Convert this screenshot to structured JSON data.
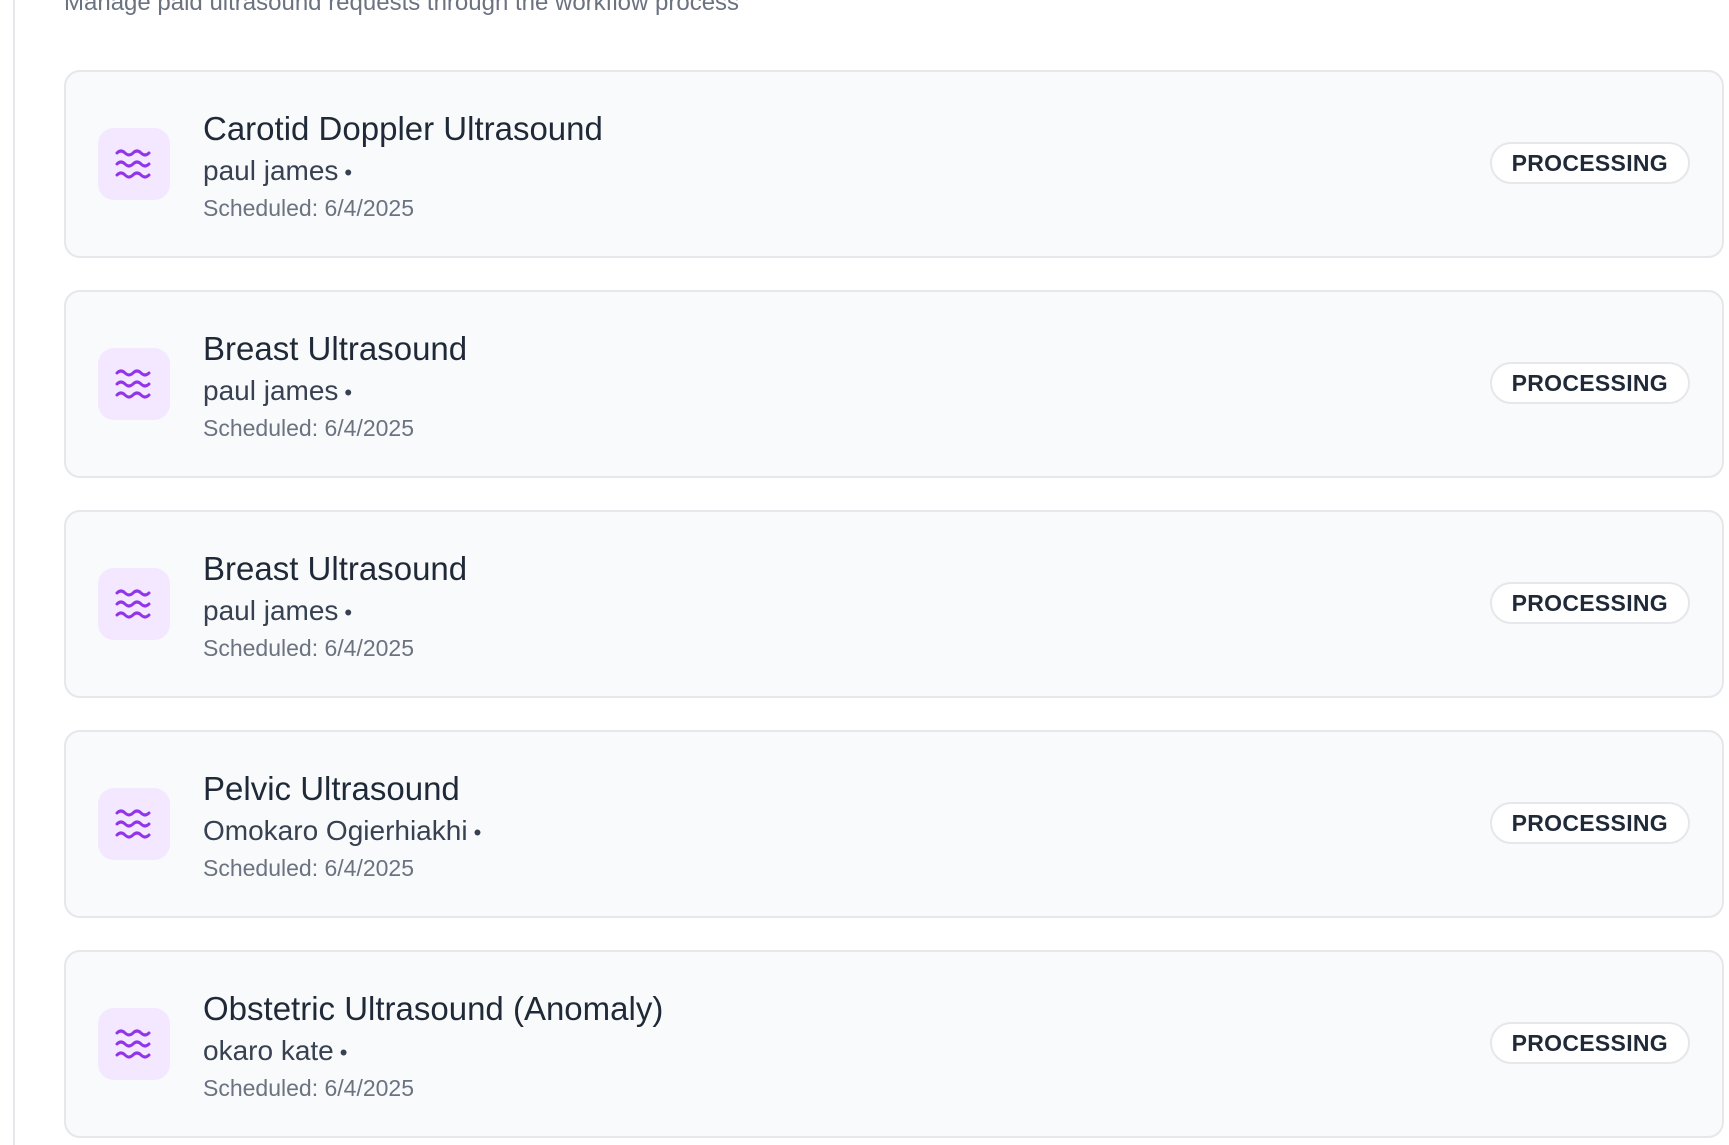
{
  "header": {
    "subtitle": "Manage paid ultrasound requests through the workflow process"
  },
  "colors": {
    "icon_bg": "#f3e8ff",
    "icon_stroke": "#9333ea",
    "card_bg": "#f9fafb",
    "border": "#e5e7eb"
  },
  "requests": [
    {
      "icon": "waves-icon",
      "title": "Carotid Doppler Ultrasound",
      "patient": "paul james",
      "separator": "•",
      "scheduled": "Scheduled: 6/4/2025",
      "status": "PROCESSING"
    },
    {
      "icon": "waves-icon",
      "title": "Breast Ultrasound",
      "patient": "paul james",
      "separator": "•",
      "scheduled": "Scheduled: 6/4/2025",
      "status": "PROCESSING"
    },
    {
      "icon": "waves-icon",
      "title": "Breast Ultrasound",
      "patient": "paul james",
      "separator": "•",
      "scheduled": "Scheduled: 6/4/2025",
      "status": "PROCESSING"
    },
    {
      "icon": "waves-icon",
      "title": "Pelvic Ultrasound",
      "patient": "Omokaro Ogierhiakhi",
      "separator": "•",
      "scheduled": "Scheduled: 6/4/2025",
      "status": "PROCESSING"
    },
    {
      "icon": "waves-icon",
      "title": "Obstetric Ultrasound (Anomaly)",
      "patient": "okaro kate",
      "separator": "•",
      "scheduled": "Scheduled: 6/4/2025",
      "status": "PROCESSING"
    }
  ]
}
